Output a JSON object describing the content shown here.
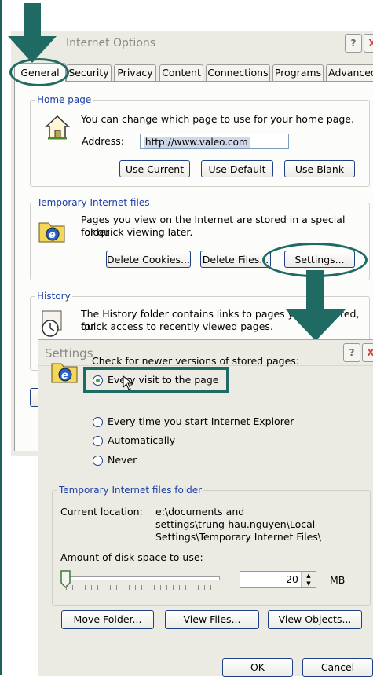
{
  "window": {
    "title": "Internet Options",
    "help_icon": "?",
    "close_icon": "X"
  },
  "tabs": [
    "General",
    "Security",
    "Privacy",
    "Content",
    "Connections",
    "Programs",
    "Advanced"
  ],
  "home_page": {
    "legend": "Home page",
    "description": "You can change which page to use for your home page.",
    "address_label": "Address:",
    "address_value": "http://www.valeo.com",
    "buttons": [
      "Use Current",
      "Use Default",
      "Use Blank"
    ]
  },
  "temp_files": {
    "legend": "Temporary Internet files",
    "description_line1": "Pages you view on the Internet are stored in a special folder",
    "description_line2": "for quick viewing later.",
    "buttons": [
      "Delete Cookies...",
      "Delete Files...",
      "Settings..."
    ]
  },
  "history": {
    "legend": "History",
    "description_line1": "The History folder contains links to pages you've visited, for",
    "description_line2": "quick access to recently viewed pages."
  },
  "settings": {
    "title": "Settings",
    "check_label": "Check for newer versions of stored pages:",
    "options": [
      "Every visit to the page",
      "Every time you start Internet Explorer",
      "Automatically",
      "Never"
    ],
    "selected_index": 0,
    "folder_legend": "Temporary Internet files folder",
    "current_location_label": "Current location:",
    "location_line1": "e:\\documents and",
    "location_line2": "settings\\trung-hau.nguyen\\Local",
    "location_line3": "Settings\\Temporary Internet Files\\",
    "disk_space_label": "Amount of disk space to use:",
    "disk_space_value": "20",
    "disk_space_unit": "MB",
    "buttons": [
      "Move Folder...",
      "View Files...",
      "View Objects..."
    ],
    "ok": "OK",
    "cancel": "Cancel"
  },
  "colors": {
    "annotation": "#1f6a63",
    "accent_link": "#1c3fa6",
    "dialog_bg": "#ecebe3"
  }
}
